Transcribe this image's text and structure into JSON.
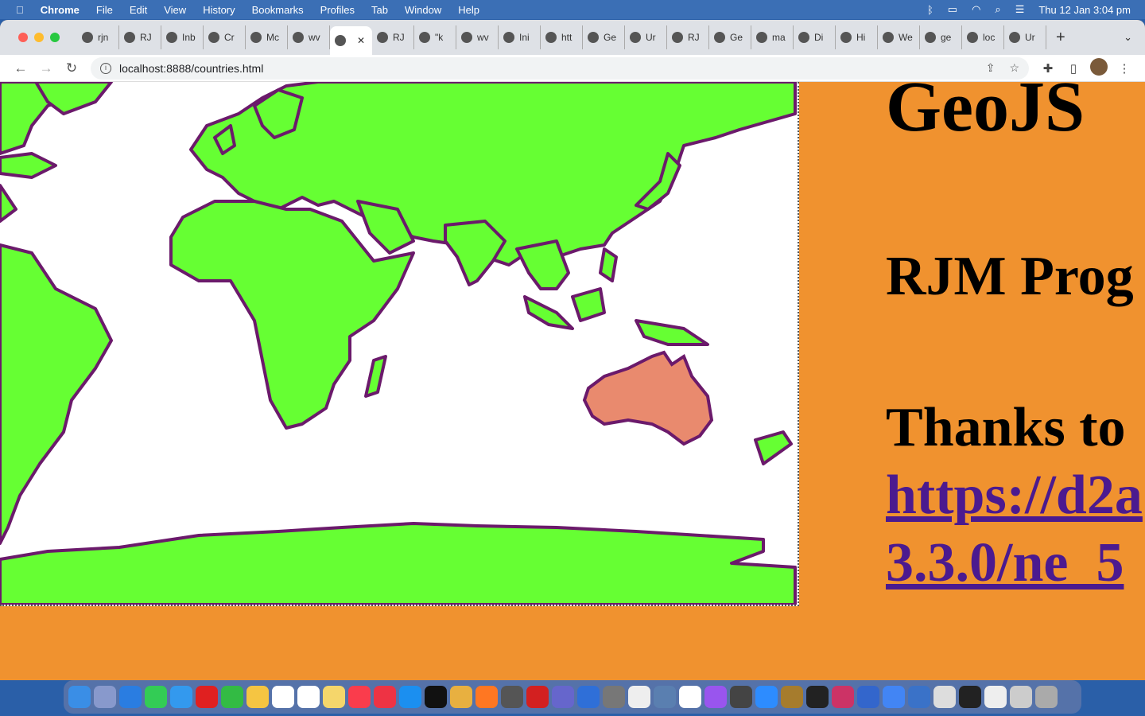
{
  "menubar": {
    "app": "Chrome",
    "items": [
      "File",
      "Edit",
      "View",
      "History",
      "Bookmarks",
      "Profiles",
      "Tab",
      "Window",
      "Help"
    ],
    "clock": "Thu 12 Jan  3:04 pm"
  },
  "tabs": [
    "rjn",
    "RJ",
    "Inb",
    "Cr",
    "Mc",
    "wv",
    "",
    "RJ",
    "\"k",
    "wv",
    "Ini",
    "htt",
    "Ge",
    "Ur",
    "RJ",
    "Ge",
    "ma",
    "Di",
    "Hi",
    "We",
    "ge",
    "loc",
    "Ur"
  ],
  "active_tab_index": 6,
  "toolbar": {
    "url": "localhost:8888/countries.html"
  },
  "page": {
    "heading": "GeoJS",
    "line1": "RJM Prog",
    "line2": "Thanks to",
    "link1": "https://d2a",
    "link2": "3.3.0/ne_5"
  },
  "colors": {
    "land": "#66ff33",
    "border": "#6b1a6b",
    "highlight": "#e98a6e",
    "page_bg": "#f0922f",
    "link": "#4b1a8f"
  },
  "map": {
    "highlighted_country": "Australia"
  },
  "dock_colors": [
    "#3a8ee6",
    "#8899cc",
    "#2a7de1",
    "#33cc55",
    "#3399ee",
    "#e02020",
    "#33bb44",
    "#f5c542",
    "#ffffff",
    "#ffffff",
    "#f5d66b",
    "#fa3c4c",
    "#ee3344",
    "#1b8ff0",
    "#111111",
    "#e8b040",
    "#ff7722",
    "#555555",
    "#d32020",
    "#6666cc",
    "#2f6fd8",
    "#777777",
    "#eeeeee",
    "#5a7fb0",
    "#ffffff",
    "#9955ee",
    "#444444",
    "#2d8cff",
    "#a67c2d",
    "#222222",
    "#cc3366",
    "#3366cc",
    "#4285f4",
    "#3a72c8",
    "#dddddd",
    "#222222",
    "#eeeeee",
    "#cccccc",
    "#aaaaaa"
  ]
}
